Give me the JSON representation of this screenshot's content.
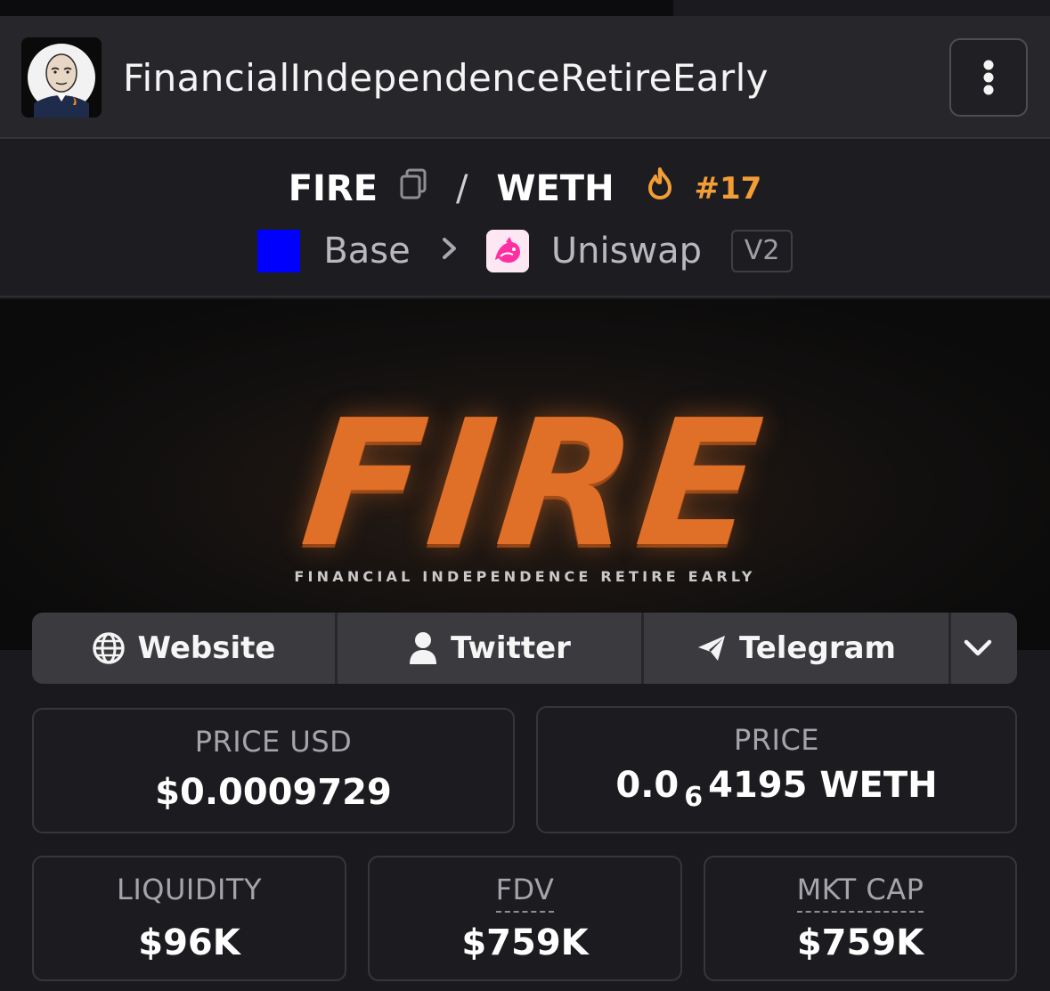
{
  "header": {
    "token_name": "FinancialIndependenceRetireEarly",
    "avatar_icon": "wojak-avatar-icon",
    "menu_icon": "kebab-menu-icon"
  },
  "pair": {
    "base_symbol": "FIRE",
    "separator": "/",
    "quote_symbol": "WETH",
    "rank": "#17",
    "chain": "Base",
    "dex": "Uniswap",
    "version": "V2"
  },
  "banner": {
    "title": "FIRE",
    "subtitle": "FINANCIAL INDEPENDENCE RETIRE EARLY"
  },
  "links": {
    "website": "Website",
    "twitter": "Twitter",
    "telegram": "Telegram"
  },
  "stats": {
    "price_usd_label": "PRICE USD",
    "price_usd_value": "$0.0009729",
    "price_label": "PRICE",
    "price_prefix": "0.0",
    "price_zeros": "6",
    "price_digits": "4195 WETH",
    "liquidity_label": "LIQUIDITY",
    "liquidity_value": "$96K",
    "fdv_label": "FDV",
    "fdv_value": "$759K",
    "mktcap_label": "MKT CAP",
    "mktcap_value": "$759K"
  },
  "colors": {
    "accent_orange": "#f29d36",
    "base_blue": "#0000ff",
    "fire_orange": "#e07028"
  }
}
